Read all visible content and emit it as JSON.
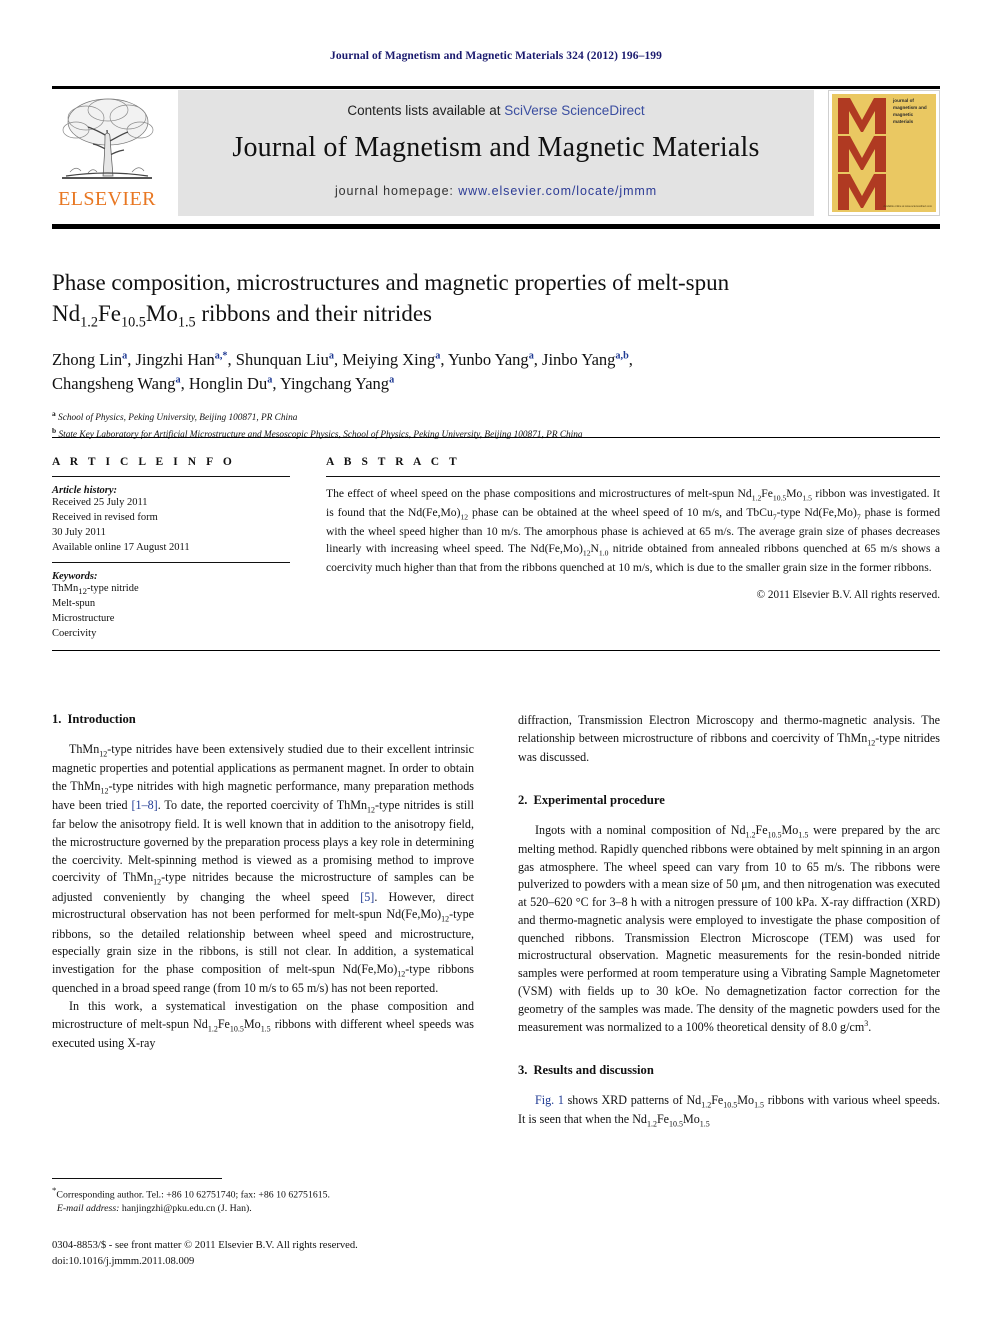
{
  "running_head": "Journal of Magnetism and Magnetic Materials 324 (2012) 196–199",
  "masthead": {
    "contents_prefix": "Contents lists available at ",
    "contents_link": "SciVerse ScienceDirect",
    "journal_title": "Journal of Magnetism and Magnetic Materials",
    "homepage_prefix": "journal homepage: ",
    "homepage_link": "www.elsevier.com/locate/jmmm",
    "publisher_name": "ELSEVIER",
    "publisher_color": "#E87722",
    "cover_caption": "journal of magnetism and magnetic materials",
    "cover_footer": "Available online at www.sciencedirect.com",
    "cover_bg": "#eac862",
    "cover_mark_color": "#b03a22",
    "link_color": "#2d3c96"
  },
  "article": {
    "title_line1": "Phase composition, microstructures and magnetic properties of melt-spun",
    "title_line2_pre": "Nd",
    "title_sub1": "1.2",
    "title_mid1": "Fe",
    "title_sub2": "10.5",
    "title_mid2": "Mo",
    "title_sub3": "1.5",
    "title_line2_post": " ribbons and their nitrides",
    "authors": [
      {
        "name": "Zhong Lin",
        "marks": "a"
      },
      {
        "name": "Jingzhi Han",
        "marks": "a,*"
      },
      {
        "name": "Shunquan Liu",
        "marks": "a"
      },
      {
        "name": "Meiying Xing",
        "marks": "a"
      },
      {
        "name": "Yunbo Yang",
        "marks": "a"
      },
      {
        "name": "Jinbo Yang",
        "marks": "a,b"
      },
      {
        "name": "Changsheng Wang",
        "marks": "a"
      },
      {
        "name": "Honglin Du",
        "marks": "a"
      },
      {
        "name": "Yingchang Yang",
        "marks": "a"
      }
    ],
    "affiliations": [
      {
        "mark": "a",
        "text": "School of Physics, Peking University, Beijing 100871, PR China"
      },
      {
        "mark": "b",
        "text": "State Key Laboratory for Artificial Microstructure and Mesoscopic Physics, School of Physics, Peking University, Beijing 100871, PR China"
      }
    ]
  },
  "article_info": {
    "heading": "A R T I C L E   I N F O",
    "history_label": "Article history:",
    "history": [
      "Received 25 July 2011",
      "Received in revised form",
      "30 July 2011",
      "Available online 17 August 2011"
    ],
    "keywords_label": "Keywords:",
    "keywords": [
      "ThMn12-type nitride",
      "Melt-spun",
      "Microstructure",
      "Coercivity"
    ]
  },
  "abstract": {
    "heading": "A B S T R A C T",
    "text": "The effect of wheel speed on the phase compositions and microstructures of melt-spun Nd1.2Fe10.5Mo1.5 ribbon was investigated. It is found that the Nd(Fe,Mo)12 phase can be obtained at the wheel speed of 10 m/s, and TbCu7-type Nd(Fe,Mo)7 phase is formed with the wheel speed higher than 10 m/s. The amorphous phase is achieved at 65 m/s. The average grain size of phases decreases linearly with increasing wheel speed. The Nd(Fe,Mo)12N1.0 nitride obtained from annealed ribbons quenched at 65 m/s shows a coercivity much higher than that from the ribbons quenched at 10 m/s, which is due to the smaller grain size in the former ribbons.",
    "copyright": "© 2011 Elsevier B.V. All rights reserved."
  },
  "sections": {
    "intro_num": "1.",
    "intro_title": "Introduction",
    "intro_p1": "ThMn12-type nitrides have been extensively studied due to their excellent intrinsic magnetic properties and potential applications as permanent magnet. In order to obtain the ThMn12-type nitrides with high magnetic performance, many preparation methods have been tried [1–8]. To date, the reported coercivity of ThMn12-type nitrides is still far below the anisotropy field. It is well known that in addition to the anisotropy field, the microstructure governed by the preparation process plays a key role in determining the coercivity. Melt-spinning method is viewed as a promising method to improve coercivity of ThMn12-type nitrides because the microstructure of samples can be adjusted conveniently by changing the wheel speed [5]. However, direct microstructural observation has not been performed for melt-spun Nd(Fe,Mo)12-type ribbons, so the detailed relationship between wheel speed and microstructure, especially grain size in the ribbons, is still not clear. In addition, a systematical investigation for the phase composition of melt-spun Nd(Fe,Mo)12-type ribbons quenched in a broad speed range (from 10 m/s to 65 m/s) has not been reported.",
    "intro_p2": "In this work, a systematical investigation on the phase composition and microstructure of melt-spun Nd1.2Fe10.5Mo1.5 ribbons with different wheel speeds was executed using X-ray",
    "intro_p2_cont": "diffraction, Transmission Electron Microscopy and thermo-magnetic analysis. The relationship between microstructure of ribbons and coercivity of ThMn12-type nitrides was discussed.",
    "exp_num": "2.",
    "exp_title": "Experimental procedure",
    "exp_p1": "Ingots with a nominal composition of Nd1.2Fe10.5Mo1.5 were prepared by the arc melting method. Rapidly quenched ribbons were obtained by melt spinning in an argon gas atmosphere. The wheel speed can vary from 10 to 65 m/s. The ribbons were pulverized to powders with a mean size of 50 μm, and then nitrogenation was executed at 520–620 °C for 3–8 h with a nitrogen pressure of 100 kPa. X-ray diffraction (XRD) and thermo-magnetic analysis were employed to investigate the phase composition of quenched ribbons. Transmission Electron Microscope (TEM) was used for microstructural observation. Magnetic measurements for the resin-bonded nitride samples were performed at room temperature using a Vibrating Sample Magnetometer (VSM) with fields up to 30 kOe. No demagnetization factor correction for the geometry of the samples was made. The density of the magnetic powders used for the measurement was normalized to a 100% theoretical density of 8.0 g/cm3.",
    "res_num": "3.",
    "res_title": "Results and discussion",
    "res_p1": "Fig. 1 shows XRD patterns of Nd1.2Fe10.5Mo1.5 ribbons with various wheel speeds. It is seen that when the Nd1.2Fe10.5Mo1.5"
  },
  "footnote": {
    "corresponding": "Corresponding author. Tel.: +86 10 62751740; fax: +86 10 62751615.",
    "email_label": "E-mail address:",
    "email": "hanjingzhi@pku.edu.cn (J. Han).",
    "imprint_line1": "0304-8853/$ - see front matter © 2011 Elsevier B.V. All rights reserved.",
    "imprint_line2": "doi:10.1016/j.jmmm.2011.08.009"
  }
}
